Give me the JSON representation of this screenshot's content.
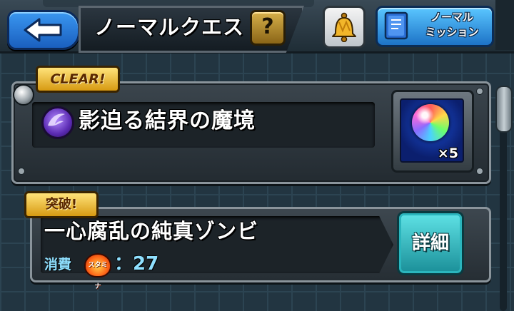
{
  "header": {
    "title": "ノーマルクエスト",
    "help_label": "?",
    "back_icon": "back-arrow-icon",
    "bell_icon": "bell-icon",
    "mission_label": "ノーマル\nミッション",
    "mission_icon": "book-icon"
  },
  "quests": [
    {
      "badge": "CLEAR!",
      "name": "影迫る結界の魔境",
      "element_icon": "dark-element-icon",
      "reward": {
        "icon": "rainbow-orb-icon",
        "count": "×5"
      }
    },
    {
      "badge": "突破!",
      "name": "一心腐乱の純真ゾンビ",
      "cost_label": "消費",
      "stamina_icon_text": "スタミナ",
      "cost_value": "：27",
      "detail_button": "詳細"
    }
  ],
  "colors": {
    "accent_blue": "#2a7fe0",
    "gold_badge": "#f0c040",
    "cyan_button": "#3cc6cc"
  }
}
